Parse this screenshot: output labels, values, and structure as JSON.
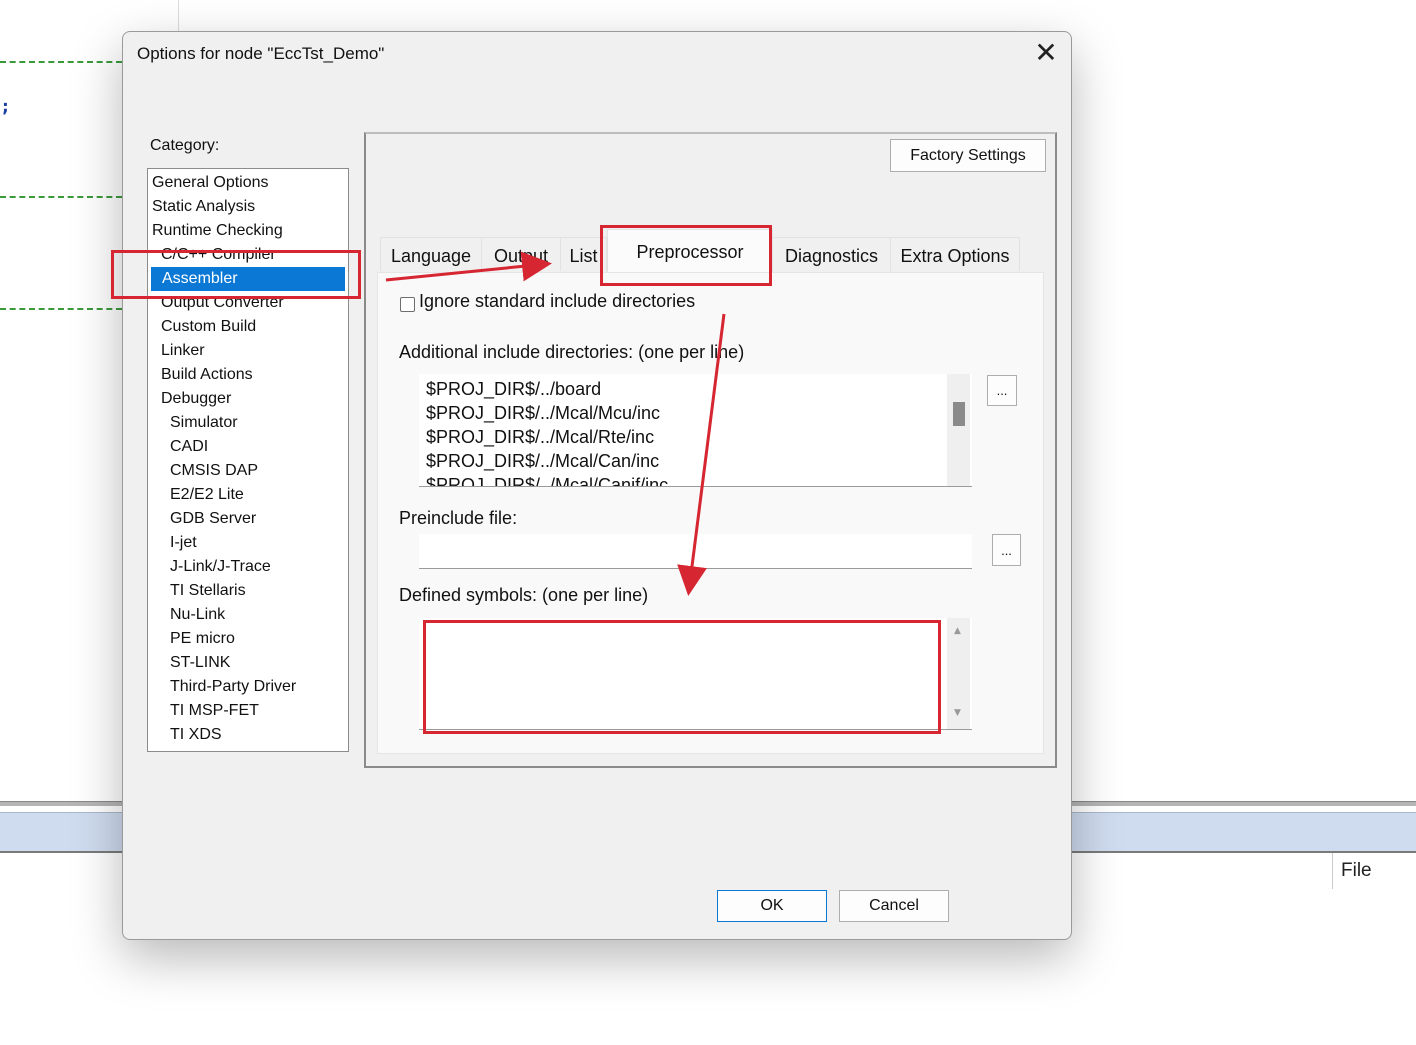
{
  "background": {
    "status_label": "File"
  },
  "dialog": {
    "title": "Options for node \"EccTst_Demo\"",
    "close_glyph": "✕",
    "category_label": "Category:",
    "categories": [
      "General Options",
      "Static Analysis",
      "Runtime Checking",
      "C/C++ Compiler",
      "Assembler",
      "Output Converter",
      "Custom Build",
      "Linker",
      "Build Actions",
      "Debugger",
      "Simulator",
      "CADI",
      "CMSIS DAP",
      "E2/E2 Lite",
      "GDB Server",
      "I-jet",
      "J-Link/J-Trace",
      "TI Stellaris",
      "Nu-Link",
      "PE micro",
      "ST-LINK",
      "Third-Party Driver",
      "TI MSP-FET",
      "TI XDS"
    ],
    "selected_category": "Assembler",
    "factory_settings": "Factory Settings",
    "tabs": [
      "Language",
      "Output",
      "List",
      "Preprocessor",
      "Diagnostics",
      "Extra Options"
    ],
    "active_tab": "Preprocessor",
    "ignore_std_label": "Ignore standard include directories",
    "ignore_std_checked": false,
    "additional_include_label": "Additional include directories:  (one per line)",
    "include_dirs": [
      "$PROJ_DIR$/../board",
      "$PROJ_DIR$/../Mcal/Mcu/inc",
      "$PROJ_DIR$/../Mcal/Rte/inc",
      "$PROJ_DIR$/../Mcal/Can/inc",
      "$PROJ_DIR$/../Mcal/Canif/inc"
    ],
    "browse_label": "...",
    "preinclude_label": "Preinclude file:",
    "preinclude_value": "",
    "defined_symbols_label": "Defined symbols:  (one per line)",
    "defined_symbols_value": "",
    "ok": "OK",
    "cancel": "Cancel"
  },
  "colors": {
    "annotation_red": "#d62631",
    "selection_blue": "#0a78d4",
    "dialog_bg": "#f0f0f0"
  }
}
